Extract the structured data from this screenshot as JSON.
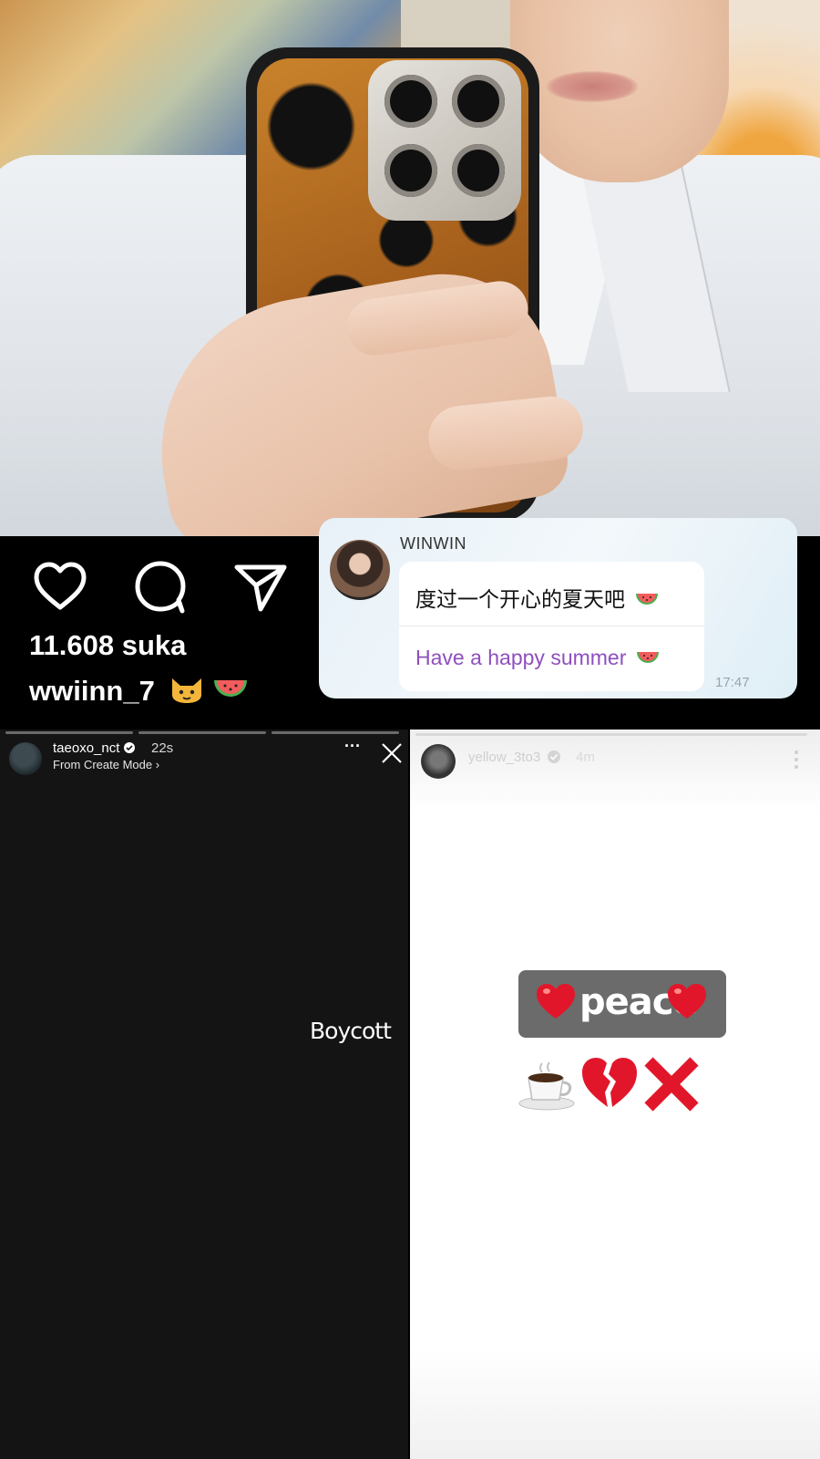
{
  "post": {
    "likes": "11.608 suka",
    "username": "wwiinn_7",
    "username_emojis": [
      "cat-face-icon",
      "watermelon-icon"
    ],
    "actions": [
      "like-icon",
      "comment-icon",
      "share-icon"
    ]
  },
  "chat": {
    "sender": "WINWIN",
    "message_zh": "度过一个开心的夏天吧",
    "message_en": "Have a happy summer",
    "time": "17:47"
  },
  "story_left": {
    "username": "taeoxo_nct",
    "time": "22s",
    "subtitle": "From Create Mode ›",
    "text": "Boycott",
    "menu_glyph": "···"
  },
  "story_right": {
    "username": "yellow_3to3",
    "time": "4m",
    "sticker_text": "peace",
    "emoji_row": [
      "coffee-icon",
      "broken-heart-icon",
      "cross-mark-icon"
    ]
  },
  "colors": {
    "chat_en_text": "#8e4fbf",
    "heart_red": "#e2162b",
    "story_left_bg": "#141414"
  }
}
